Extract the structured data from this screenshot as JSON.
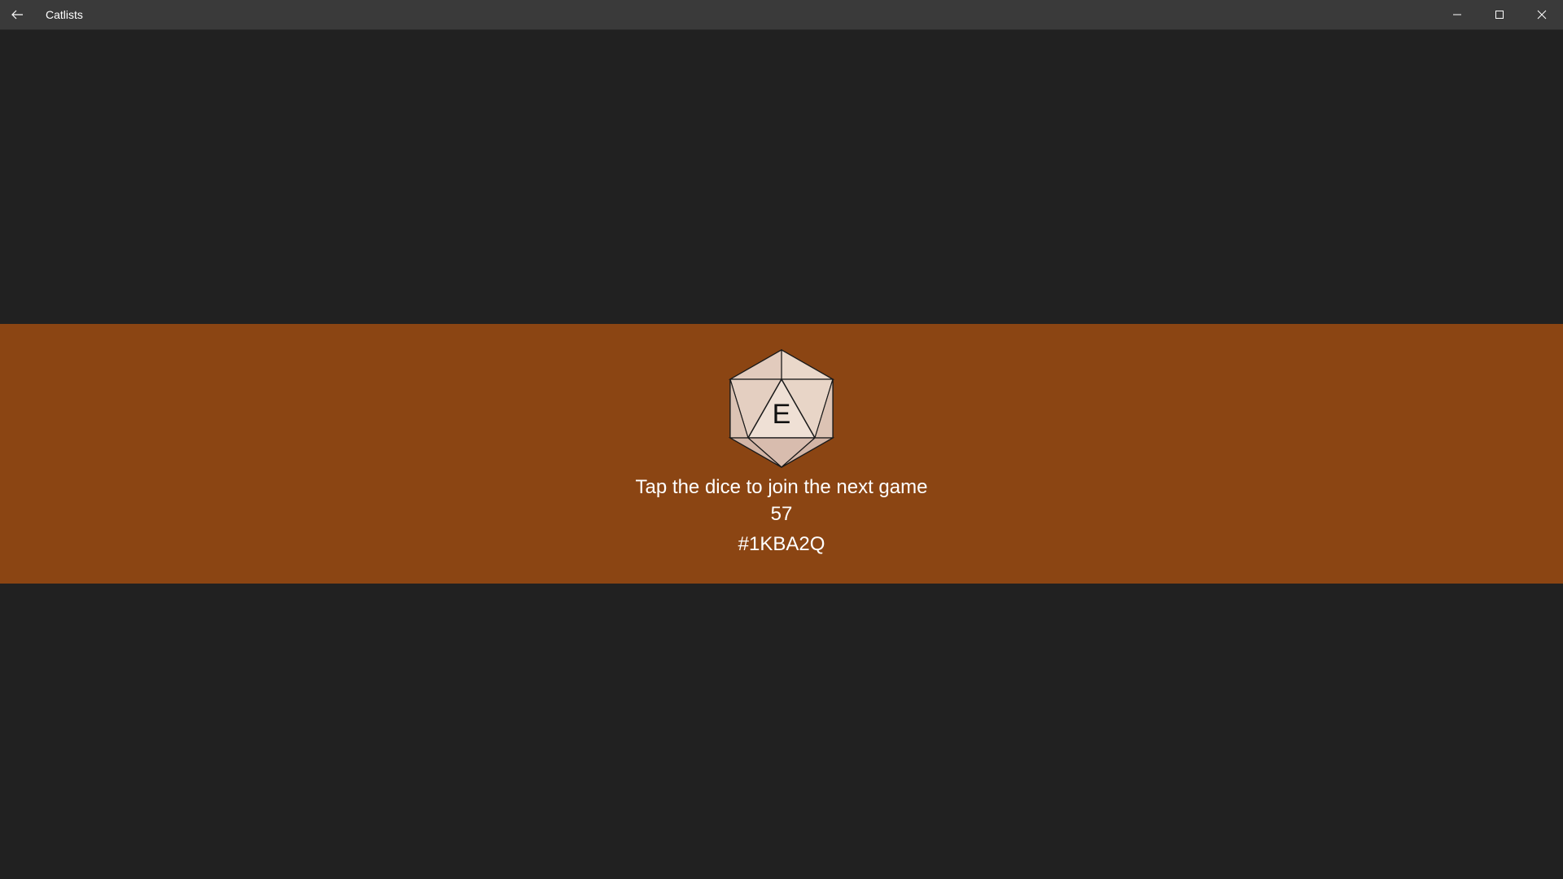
{
  "window": {
    "title": "Catlists",
    "back_icon": "back-arrow-icon",
    "minimize_icon": "minimize-icon",
    "maximize_icon": "maximize-icon",
    "close_icon": "close-icon"
  },
  "colors": {
    "background": "#212121",
    "titlebar": "#3a3a3a",
    "banner": "#8b4513",
    "dice_face_light": "#e6d2c3",
    "dice_face_dark": "#d8bcae",
    "text": "#ffffff"
  },
  "game": {
    "dice_icon": "d20-dice-icon",
    "dice_letter": "E",
    "prompt": "Tap the dice to join the next game",
    "count": "57",
    "code": "#1KBA2Q"
  }
}
